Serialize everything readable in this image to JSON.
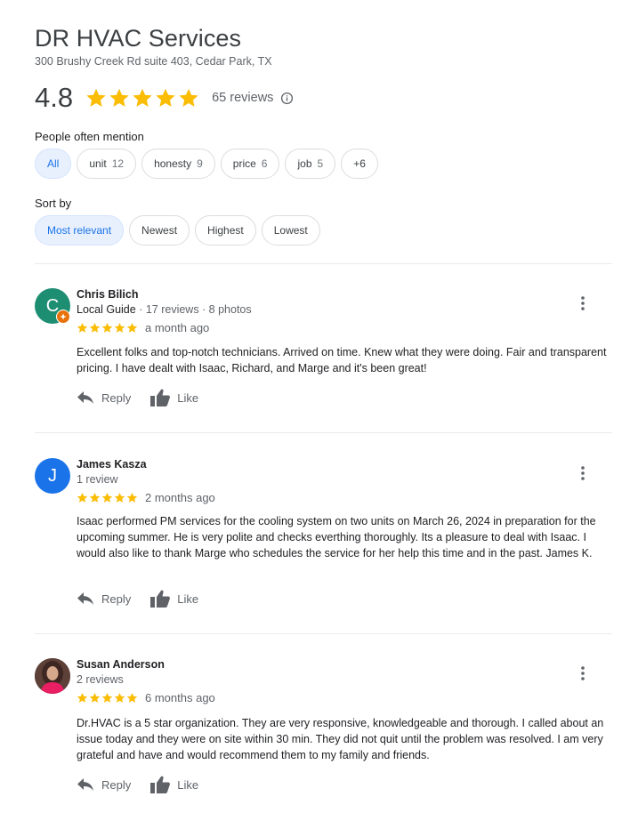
{
  "business": {
    "name": "DR HVAC Services",
    "address": "300 Brushy Creek Rd suite 403, Cedar Park, TX",
    "rating": "4.8",
    "rating_value": 4.8,
    "review_count": "65 reviews"
  },
  "mentions": {
    "label": "People often mention",
    "chips": [
      {
        "label": "All",
        "count": ""
      },
      {
        "label": "unit",
        "count": "12"
      },
      {
        "label": "honesty",
        "count": "9"
      },
      {
        "label": "price",
        "count": "6"
      },
      {
        "label": "job",
        "count": "5"
      },
      {
        "label": "+6",
        "count": ""
      }
    ]
  },
  "sort": {
    "label": "Sort by",
    "options": [
      "Most relevant",
      "Newest",
      "Highest",
      "Lowest"
    ],
    "selected": "Most relevant"
  },
  "reviews": [
    {
      "author": "Chris Bilich",
      "initial": "C",
      "avatar_color": "#1e8e73",
      "local_guide": "Local Guide",
      "meta": " · 17 reviews · 8 photos",
      "stars": 5,
      "time": "a month ago",
      "text": "Excellent folks and top-notch technicians. Arrived on time. Knew what they were doing. Fair and transparent pricing.  I have dealt with Isaac, Richard, and Marge and it's been great!",
      "reply": "Reply",
      "like": "Like"
    },
    {
      "author": "James Kasza",
      "initial": "J",
      "avatar_color": "#1a73e8",
      "local_guide": "",
      "meta": "1 review",
      "stars": 5,
      "time": "2 months ago",
      "text": "Isaac performed PM services for the cooling system on two units on March 26, 2024 in preparation for the upcoming summer. He is very polite and checks everthing thoroughly. Its a pleasure to deal with Isaac. I would also like to thank Marge who schedules the service for her help this time and in the past. James K.",
      "reply": "Reply",
      "like": "Like"
    },
    {
      "author": "Susan Anderson",
      "initial": "",
      "avatar_color": "#6d4c41",
      "local_guide": "",
      "meta": "2 reviews",
      "stars": 5,
      "time": "6 months ago",
      "text": "Dr.HVAC is a 5 star organization.  They are very responsive, knowledgeable and thorough.  I called about an issue today and they were on site within 30 min. They did not quit until the problem was resolved.  I am very grateful and have and would recommend them to my family and friends.",
      "reply": "Reply",
      "like": "Like"
    }
  ],
  "colors": {
    "star": "#fbbc04",
    "accent": "#1a73e8",
    "chip_active_bg": "#e8f0fe"
  },
  "icons": [
    "star-icon",
    "info-icon",
    "more-vert-icon",
    "reply-icon",
    "thumb-up-icon",
    "local-guide-badge-icon"
  ]
}
